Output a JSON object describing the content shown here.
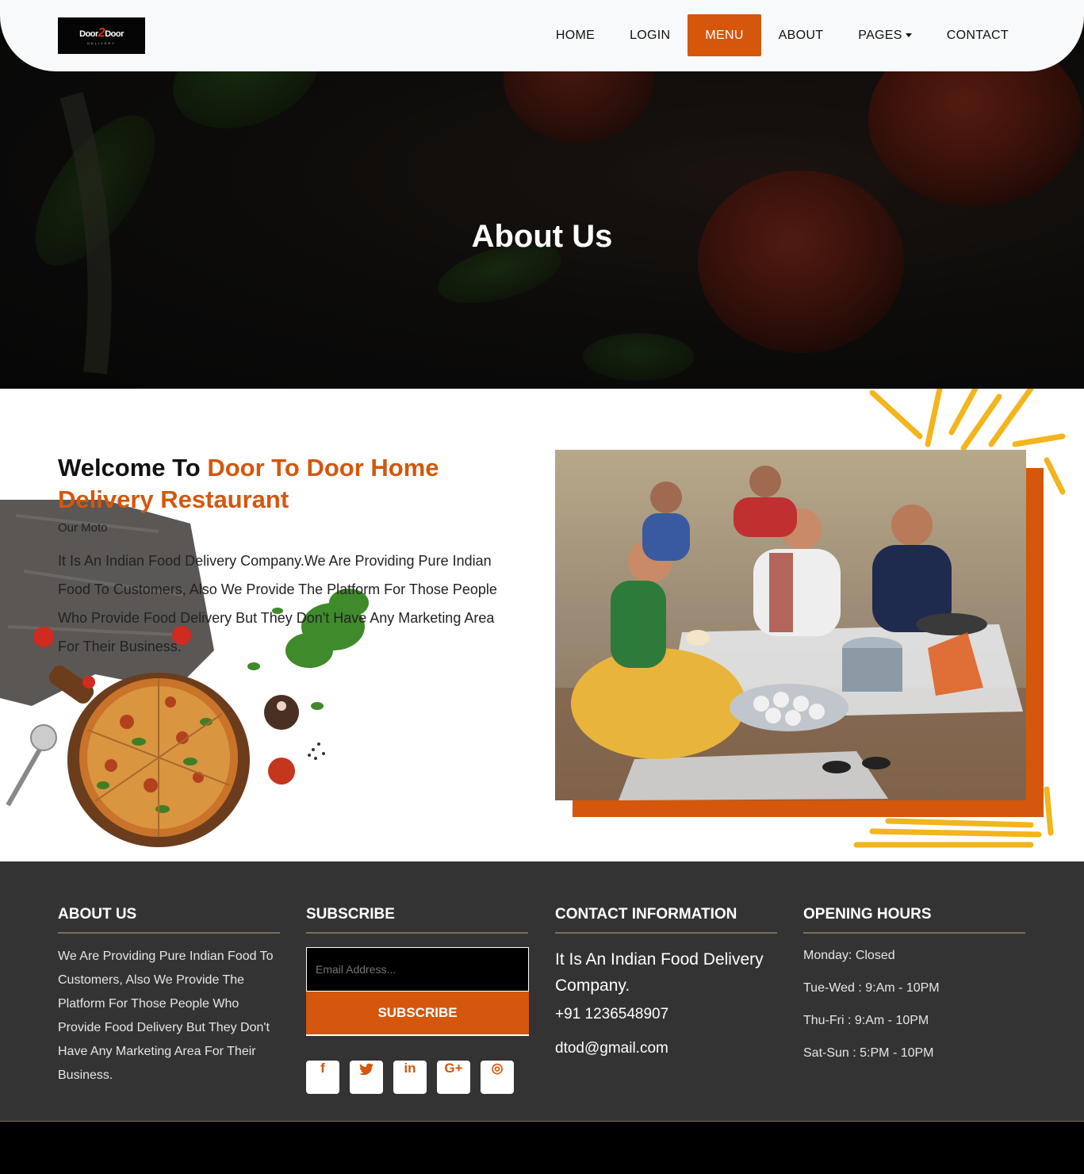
{
  "nav": {
    "logo_text": "Door 2 Door",
    "logo_sub": "DELIVERY",
    "items": [
      {
        "label": "HOME"
      },
      {
        "label": "LOGIN"
      },
      {
        "label": "MENU"
      },
      {
        "label": "ABOUT"
      },
      {
        "label": "PAGES"
      },
      {
        "label": "CONTACT"
      }
    ],
    "active": "MENU"
  },
  "hero": {
    "title": "About Us"
  },
  "about": {
    "heading_plain": "Welcome To ",
    "heading_accent": "Door To Door Home Delivery Restaurant",
    "subheading": "Our Moto",
    "body": "It Is An Indian Food Delivery Company.We Are Providing Pure Indian Food To Customers, Also We Provide The Platform For Those People Who Provide Food Delivery But They Don't Have Any Marketing Area For Their Business."
  },
  "footer": {
    "about": {
      "title": "ABOUT US",
      "text": "We Are Providing Pure Indian Food To Customers, Also We Provide The Platform For Those People Who Provide Food Delivery But They Don't Have Any Marketing Area For Their Business."
    },
    "subscribe": {
      "title": "SUBSCRIBE",
      "email_placeholder": "Email Address...",
      "button": "SUBSCRIBE",
      "socials": [
        {
          "icon": "facebook-icon",
          "glyph": "f"
        },
        {
          "icon": "twitter-icon",
          "glyph": "🐦"
        },
        {
          "icon": "linkedin-icon",
          "glyph": "in"
        },
        {
          "icon": "google-plus-icon",
          "glyph": "G+"
        },
        {
          "icon": "instagram-icon",
          "glyph": "◎"
        }
      ]
    },
    "contact": {
      "title": "CONTACT INFORMATION",
      "desc": "It Is An Indian Food Delivery Company.",
      "phone": "+91 1236548907",
      "email": "dtod@gmail.com"
    },
    "hours": {
      "title": "OPENING HOURS",
      "rows": [
        "Monday: Closed",
        "Tue-Wed : 9:Am - 10PM",
        "Thu-Fri : 9:Am - 10PM",
        "Sat-Sun : 5:PM - 10PM"
      ]
    }
  },
  "colors": {
    "accent": "#d4570c",
    "footer_bg": "#333333",
    "nav_bg": "#f8f9fa"
  }
}
